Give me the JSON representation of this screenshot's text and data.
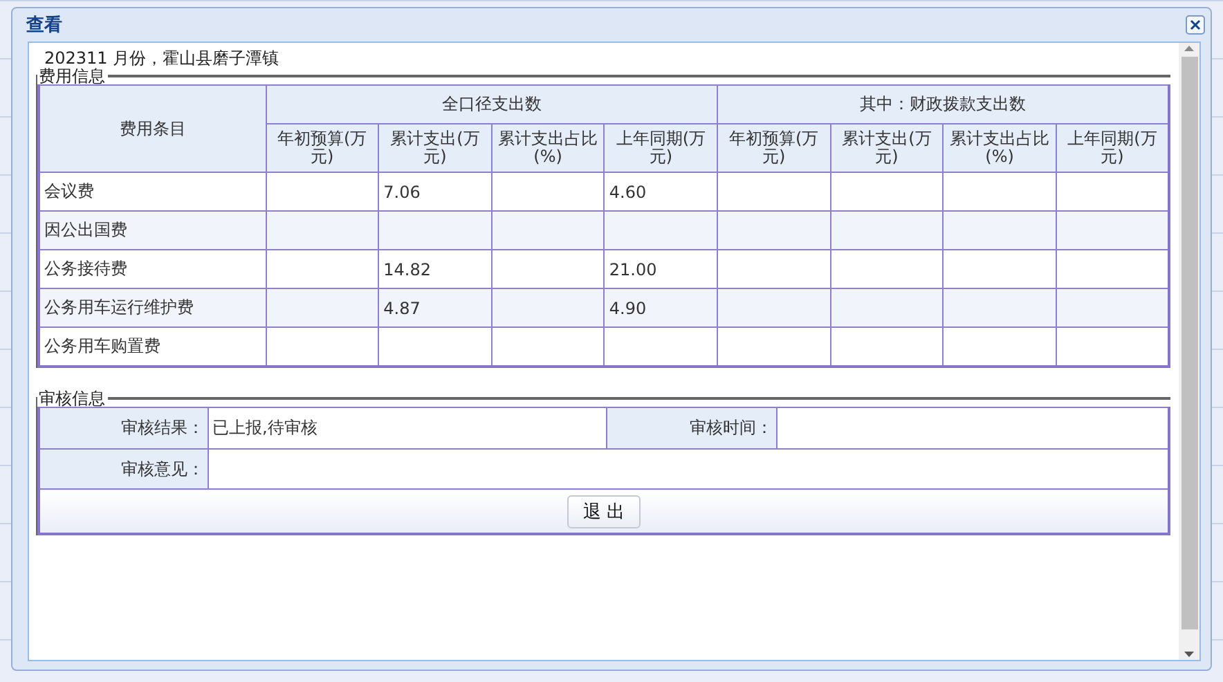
{
  "window": {
    "title": "查看"
  },
  "subtitle": "202311 月份，霍山县磨子潭镇",
  "expense": {
    "legend": "费用信息",
    "item_header": "费用条目",
    "groups": [
      {
        "label": "全口径支出数",
        "columns": [
          "年初预算(万元)",
          "累计支出(万元)",
          "累计支出占比(%)",
          "上年同期(万元)"
        ]
      },
      {
        "label": "其中：财政拨款支出数",
        "columns": [
          "年初预算(万元)",
          "累计支出(万元)",
          "累计支出占比(%)",
          "上年同期(万元)"
        ]
      }
    ],
    "rows": [
      {
        "item": "会议费",
        "cells": [
          null,
          "7.06",
          null,
          "4.60",
          null,
          null,
          null,
          null
        ]
      },
      {
        "item": "因公出国费",
        "cells": [
          null,
          null,
          null,
          null,
          null,
          null,
          null,
          null
        ]
      },
      {
        "item": "公务接待费",
        "cells": [
          null,
          "14.82",
          null,
          "21.00",
          null,
          null,
          null,
          null
        ]
      },
      {
        "item": "公务用车运行维护费",
        "cells": [
          null,
          "4.87",
          null,
          "4.90",
          null,
          null,
          null,
          null
        ]
      },
      {
        "item": "公务用车购置费",
        "cells": [
          null,
          null,
          null,
          null,
          null,
          null,
          null,
          null
        ]
      }
    ]
  },
  "audit": {
    "legend": "审核信息",
    "result_label": "审核结果：",
    "result_value": "已上报,待审核",
    "time_label": "审核时间：",
    "opinion_label": "审核意见："
  },
  "buttons": [
    "退 出"
  ]
}
